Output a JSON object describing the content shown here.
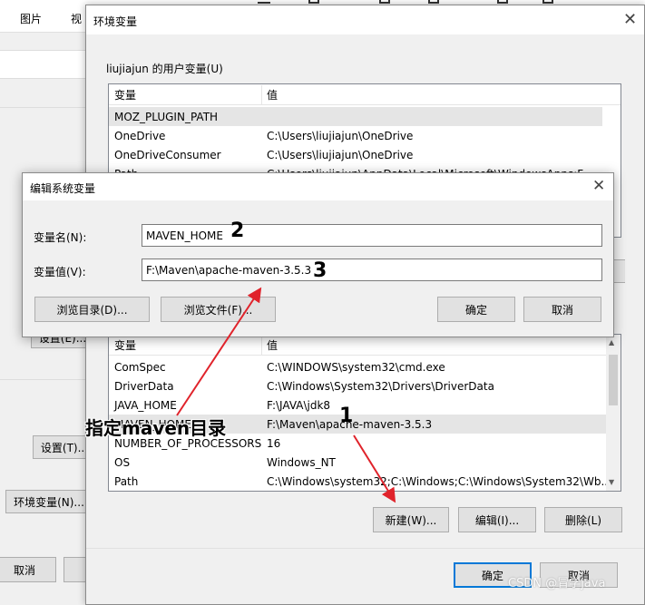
{
  "background": {
    "toolbar_items": [
      "图片",
      "视"
    ],
    "settings_btn_1": "设置(E)...",
    "settings_btn_2": "设置(T)...",
    "env_btn": "环境变量(N)...",
    "cancel": "取消"
  },
  "env_dialog": {
    "title": "环境变量",
    "user_group_label": "liujiajun 的用户变量(U)",
    "columns": [
      "变量",
      "值"
    ],
    "user_vars": [
      {
        "name": "MOZ_PLUGIN_PATH",
        "value": ""
      },
      {
        "name": "OneDrive",
        "value": "C:\\Users\\liujiajun\\OneDrive"
      },
      {
        "name": "OneDriveConsumer",
        "value": "C:\\Users\\liujiajun\\OneDrive"
      },
      {
        "name": "Path",
        "value": "C:\\Users\\liujiajun\\AppData\\Local\\Microsoft\\WindowsApps;F..."
      }
    ],
    "system_vars": [
      {
        "name": "ComSpec",
        "value": "C:\\WINDOWS\\system32\\cmd.exe"
      },
      {
        "name": "DriverData",
        "value": "C:\\Windows\\System32\\Drivers\\DriverData"
      },
      {
        "name": "JAVA_HOME",
        "value": "F:\\JAVA\\jdk8"
      },
      {
        "name": "MAVEN_HOME",
        "value": "F:\\Maven\\apache-maven-3.5.3"
      },
      {
        "name": "NUMBER_OF_PROCESSORS",
        "value": "16"
      },
      {
        "name": "OS",
        "value": "Windows_NT"
      },
      {
        "name": "Path",
        "value": "C:\\Windows\\system32;C:\\Windows;C:\\Windows\\System32\\Wb..."
      }
    ],
    "new_btn": "新建(W)...",
    "edit_btn": "编辑(I)...",
    "delete_btn": "删除(L)",
    "ok_btn": "确定",
    "cancel_btn": "取消"
  },
  "edit_dialog": {
    "title": "编辑系统变量",
    "name_label": "变量名(N):",
    "name_value": "MAVEN_HOME",
    "value_label": "变量值(V):",
    "value_value": "F:\\Maven\\apache-maven-3.5.3",
    "browse_dir_btn": "浏览目录(D)...",
    "browse_file_btn": "浏览文件(F)...",
    "ok_btn": "确定",
    "cancel_btn": "取消"
  },
  "annotations": {
    "label": "指定maven目录",
    "n1": "1",
    "n2": "2",
    "n3": "3",
    "watermark": "CSDN @冒学java",
    "accent": "#e0232b"
  }
}
